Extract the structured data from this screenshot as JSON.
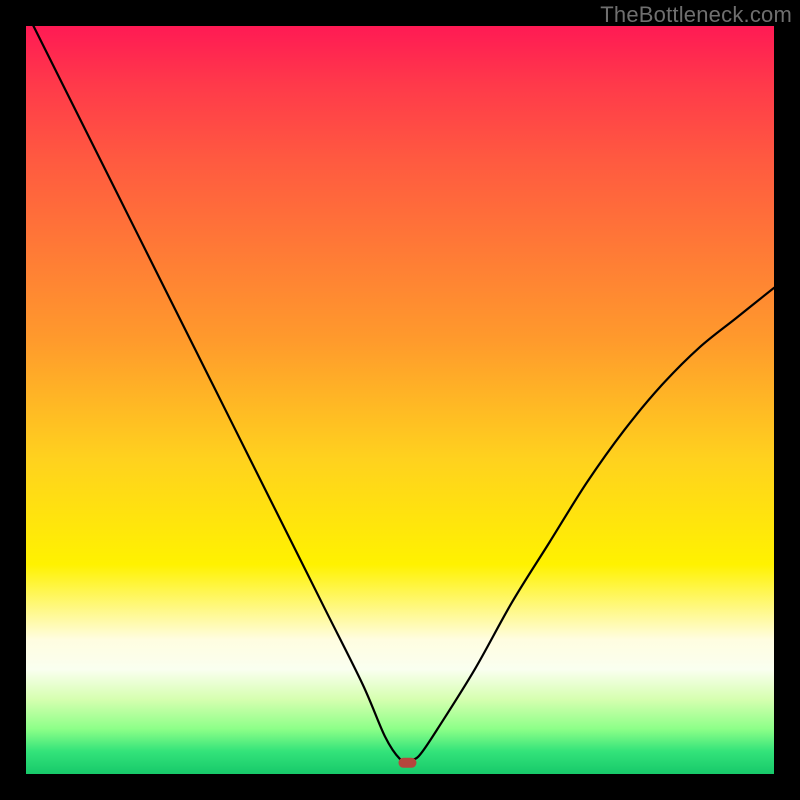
{
  "watermark": "TheBottleneck.com",
  "chart_data": {
    "type": "line",
    "title": "",
    "xlabel": "",
    "ylabel": "",
    "xlim": [
      0,
      100
    ],
    "ylim": [
      0,
      100
    ],
    "grid": false,
    "legend": false,
    "background": "heatmap-gradient",
    "series": [
      {
        "name": "bottleneck-curve",
        "x": [
          0,
          5,
          10,
          15,
          20,
          25,
          30,
          35,
          40,
          45,
          48,
          50,
          51,
          52,
          53,
          55,
          60,
          65,
          70,
          75,
          80,
          85,
          90,
          95,
          100
        ],
        "values": [
          102,
          92,
          82,
          72,
          62,
          52,
          42,
          32,
          22,
          12,
          5,
          2,
          2,
          2,
          3,
          6,
          14,
          23,
          31,
          39,
          46,
          52,
          57,
          61,
          65
        ]
      }
    ],
    "marker": {
      "x": 51,
      "y": 1.5,
      "shape": "rounded-rect",
      "color": "#b5463d"
    }
  },
  "colors": {
    "frame": "#000000",
    "watermark": "#6f6f6f",
    "gradient_top": "#ff1a54",
    "gradient_mid": "#fff200",
    "gradient_bottom": "#17c96a",
    "curve": "#000000",
    "marker": "#b5463d"
  }
}
